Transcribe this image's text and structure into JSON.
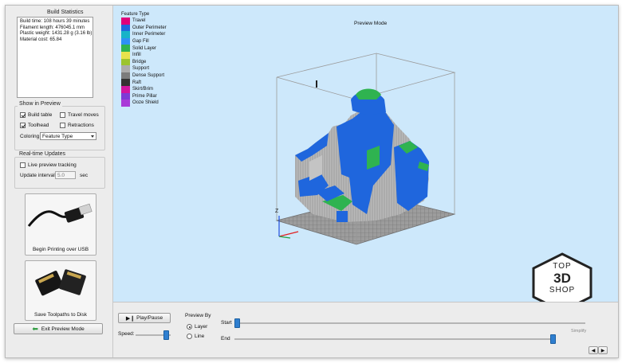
{
  "build_stats": {
    "title": "Build Statistics",
    "lines": [
      "Build time: 108 hours 39 minutes",
      "Filament length: 476045.1 mm",
      "Plastic weight: 1431.28 g (3.16 lb)",
      "Material cost: 65.84"
    ]
  },
  "show_in_preview": {
    "title": "Show in Preview",
    "build_table": "Build table",
    "travel_moves": "Travel moves",
    "toolhead": "Toolhead",
    "retractions": "Retractions",
    "coloring_label": "Coloring",
    "coloring_value": "Feature Type"
  },
  "realtime": {
    "title": "Real-time Updates",
    "live_tracking": "Live preview tracking",
    "interval_label": "Update interval",
    "interval_value": "5.0",
    "interval_unit": "sec"
  },
  "usb_button": "Begin Printing over USB",
  "disk_button": "Save Toolpaths to Disk",
  "exit_button": "Exit Preview Mode",
  "viewport": {
    "mode_title": "Preview Mode",
    "legend_title": "Feature Type",
    "legend": [
      {
        "label": "Travel",
        "color": "#e0007a"
      },
      {
        "label": "Outer Perimeter",
        "color": "#1f66dd"
      },
      {
        "label": "Inner Perimeter",
        "color": "#17b3c8"
      },
      {
        "label": "Gap Fill",
        "color": "#2e90f5"
      },
      {
        "label": "Solid Layer",
        "color": "#2fb350"
      },
      {
        "label": "Infill",
        "color": "#e7e34c"
      },
      {
        "label": "Bridge",
        "color": "#9cc42e"
      },
      {
        "label": "Support",
        "color": "#ababab"
      },
      {
        "label": "Dense Support",
        "color": "#7c7c7c"
      },
      {
        "label": "Raft",
        "color": "#333333"
      },
      {
        "label": "Skirt/Brim",
        "color": "#d1169f"
      },
      {
        "label": "Prime Pillar",
        "color": "#7d3bd6"
      },
      {
        "label": "Ooze Shield",
        "color": "#a93bd8"
      }
    ],
    "axis_z": "Z"
  },
  "controls": {
    "play_pause": "Play/Pause",
    "speed_label": "Speed:",
    "preview_by": "Preview By",
    "layer": "Layer",
    "line": "Line",
    "start": "Start",
    "end": "End",
    "simplify": "Simplify"
  },
  "watermark": {
    "line1": "TOP",
    "line2": "3D",
    "line3": "SHOP"
  }
}
